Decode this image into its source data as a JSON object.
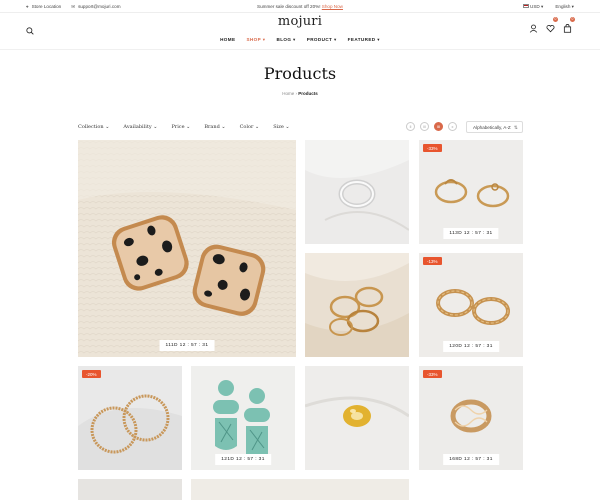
{
  "topbar": {
    "store_location": "Store Location",
    "email": "support@mojuri.com",
    "promo_text": "Summer sale discount off 20%!",
    "promo_link": "Shop Now",
    "currency": "USD",
    "language": "English"
  },
  "header": {
    "logo": "mojuri",
    "wishlist_count": "0",
    "cart_count": "0",
    "nav": [
      {
        "label": "HOME"
      },
      {
        "label": "SHOP"
      },
      {
        "label": "BLOG"
      },
      {
        "label": "PRODUCT"
      },
      {
        "label": "FEATURED"
      }
    ]
  },
  "page": {
    "title": "Products",
    "breadcrumb_home": "Home",
    "breadcrumb_current": "Products"
  },
  "filters": [
    "Collection",
    "Availability",
    "Price",
    "Brand",
    "Color",
    "Size"
  ],
  "view_options": [
    "II",
    "III",
    "IIII",
    "≡"
  ],
  "sort": {
    "selected": "Alphabetically, A-Z"
  },
  "products": [
    {
      "timer": "111D  12 : 57 : 31",
      "sale": ""
    },
    {
      "timer": "",
      "sale": ""
    },
    {
      "timer": "113D  12 : 57 : 31",
      "sale": "-33%"
    },
    {
      "timer": "",
      "sale": ""
    },
    {
      "timer": "120D  12 : 57 : 31",
      "sale": "-13%"
    },
    {
      "timer": "",
      "sale": "-20%"
    },
    {
      "timer": "121D  12 : 57 : 31",
      "sale": ""
    },
    {
      "timer": "",
      "sale": ""
    },
    {
      "timer": "168D  12 : 57 : 31",
      "sale": "-33%"
    }
  ],
  "colors": {
    "accent": "#d9694a",
    "sale_badge": "#e8552e"
  }
}
